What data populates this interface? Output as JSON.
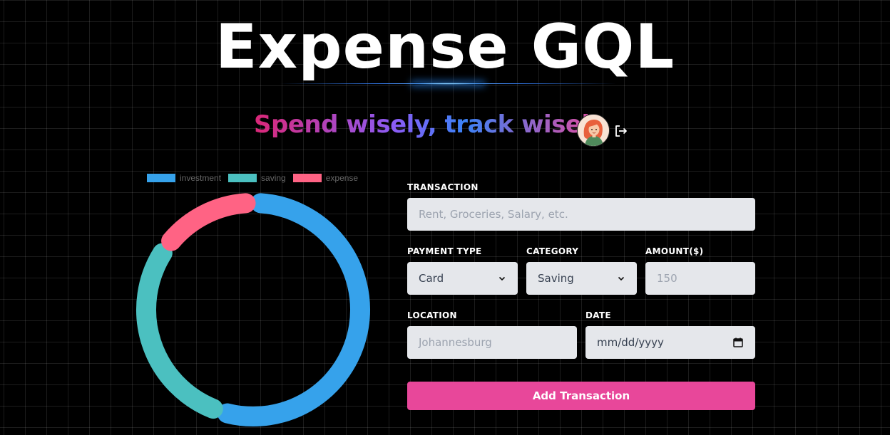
{
  "header": {
    "title": "Expense GQL",
    "tagline": "Spend wisely, track wisely"
  },
  "user": {
    "avatar": "avatar-icon",
    "logout_icon": "logout-icon"
  },
  "chart": {
    "legend": [
      {
        "label": "investment",
        "color": "#36A2EB"
      },
      {
        "label": "saving",
        "color": "#4BC0C0"
      },
      {
        "label": "expense",
        "color": "#FF6384"
      }
    ]
  },
  "chart_data": {
    "type": "pie",
    "categories": [
      "investment",
      "saving",
      "expense"
    ],
    "values": [
      55,
      30,
      15
    ],
    "colors": [
      "#36A2EB",
      "#4BC0C0",
      "#FF6384"
    ],
    "legend_position": "top"
  },
  "form": {
    "transaction": {
      "label": "TRANSACTION",
      "placeholder": "Rent, Groceries, Salary, etc."
    },
    "payment_type": {
      "label": "PAYMENT TYPE",
      "value": "Card"
    },
    "category": {
      "label": "CATEGORY",
      "value": "Saving"
    },
    "amount": {
      "label": "AMOUNT($)",
      "placeholder": "150"
    },
    "location": {
      "label": "LOCATION",
      "placeholder": "Johannesburg"
    },
    "date": {
      "label": "DATE",
      "placeholder": "mm/dd/yyyy"
    },
    "submit_label": "Add Transaction"
  }
}
